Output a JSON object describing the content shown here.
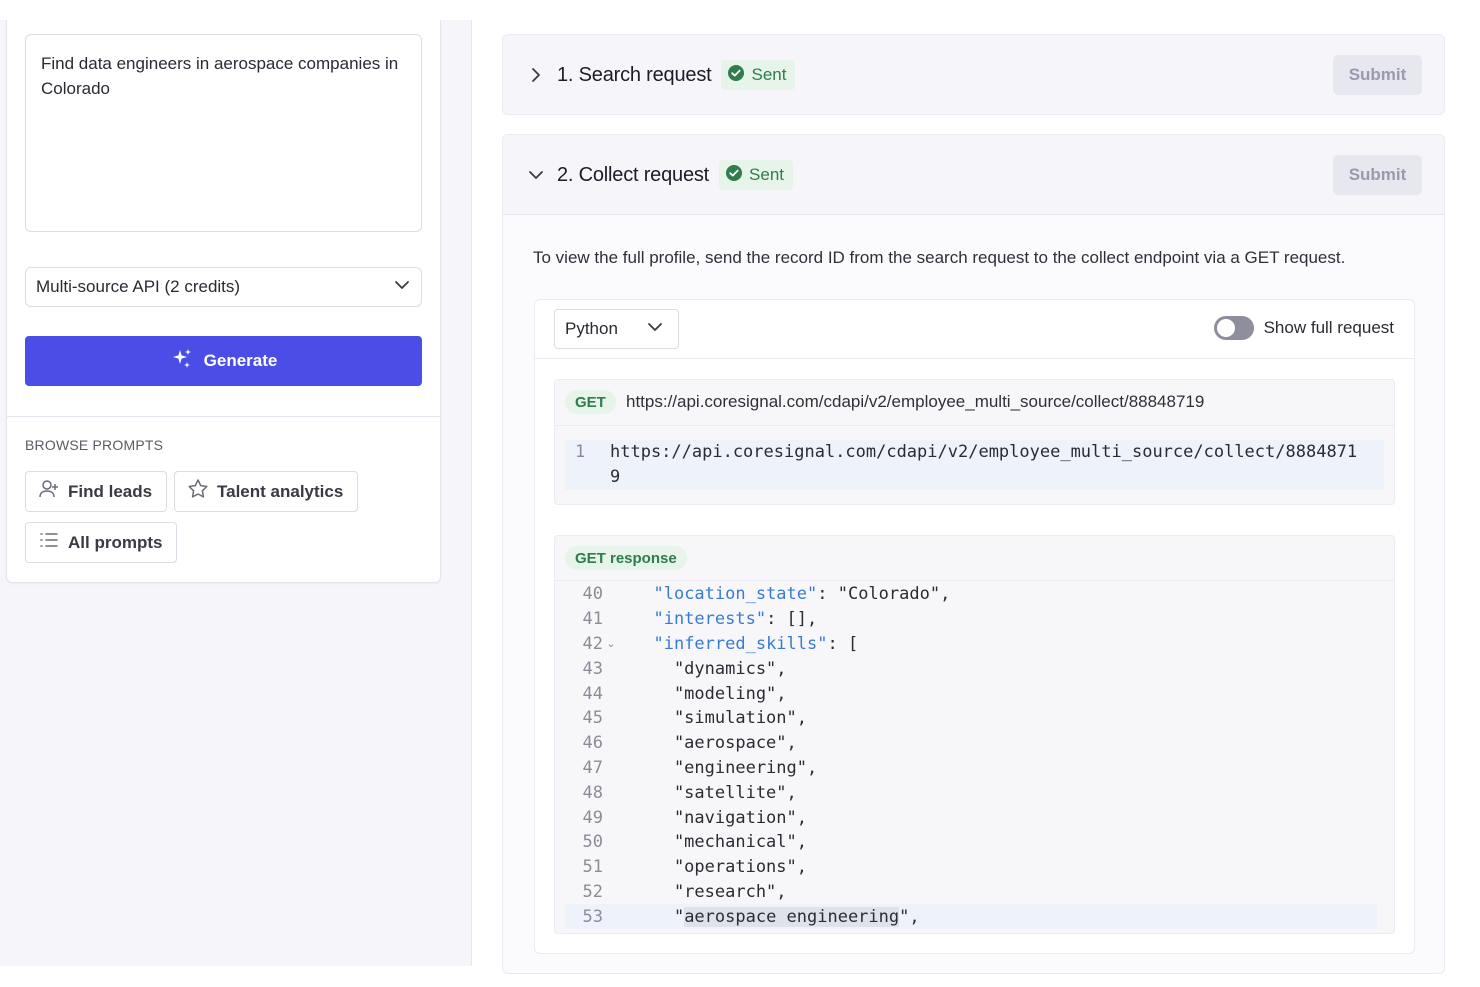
{
  "left": {
    "prompt_text": "Find data engineers in aerospace companies in Colorado",
    "api_select": "Multi-source API (2 credits)",
    "generate_label": "Generate",
    "browse_title": "BROWSE PROMPTS",
    "chips": [
      "Find leads",
      "Talent analytics",
      "All prompts"
    ]
  },
  "steps": {
    "search": {
      "title": "1. Search request",
      "status": "Sent",
      "submit": "Submit"
    },
    "collect": {
      "title": "2. Collect request",
      "status": "Sent",
      "submit": "Submit",
      "description": "To view the full profile, send the record ID from the search request to the collect endpoint via a GET request.",
      "language": "Python",
      "toggle_label": "Show full request",
      "method": "GET",
      "url": "https://api.coresignal.com/cdapi/v2/employee_multi_source/collect/88848719",
      "code_line_no": "1",
      "code_line_a": "https://api.coresignal.com/cdapi/v2/employee_multi_source/collect/8884871",
      "code_line_b": "9",
      "response_label": "GET response"
    }
  },
  "response_lines": [
    {
      "n": "40",
      "text": "  \"location_state\": \"Colorado\","
    },
    {
      "n": "41",
      "text": "  \"interests\": [],"
    },
    {
      "n": "42",
      "text": "  \"inferred_skills\": ["
    },
    {
      "n": "43",
      "text": "    \"dynamics\","
    },
    {
      "n": "44",
      "text": "    \"modeling\","
    },
    {
      "n": "45",
      "text": "    \"simulation\","
    },
    {
      "n": "46",
      "text": "    \"aerospace\","
    },
    {
      "n": "47",
      "text": "    \"engineering\","
    },
    {
      "n": "48",
      "text": "    \"satellite\","
    },
    {
      "n": "49",
      "text": "    \"navigation\","
    },
    {
      "n": "50",
      "text": "    \"mechanical\","
    },
    {
      "n": "51",
      "text": "    \"operations\","
    },
    {
      "n": "52",
      "text": "    \"research\","
    },
    {
      "n": "53",
      "text": "    \"aerospace engineering\","
    }
  ],
  "colors": {
    "accent": "#4a4ee6",
    "sent_bg": "#e6f4ea",
    "sent_text": "#2e7d4a",
    "json_key": "#3a7ad6"
  }
}
